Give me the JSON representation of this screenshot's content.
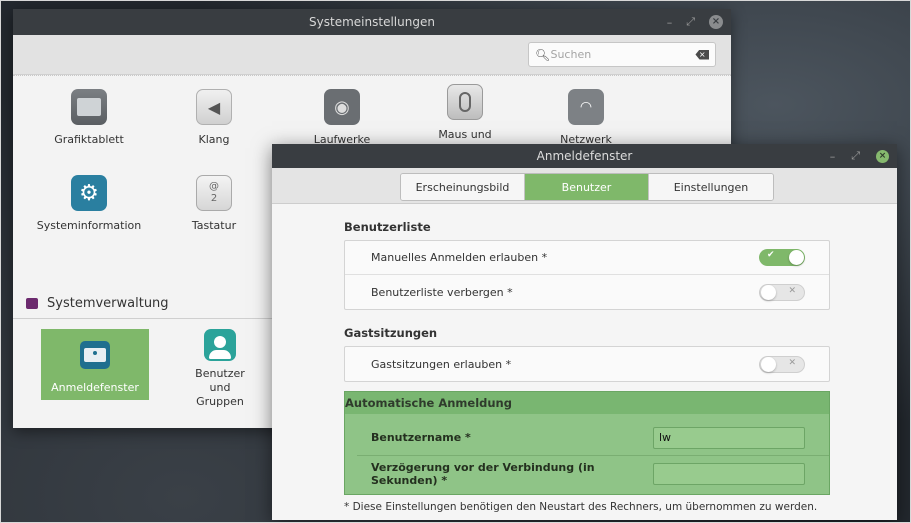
{
  "main_window": {
    "title": "Systemeinstellungen",
    "search": {
      "placeholder": "Suchen",
      "value": ""
    },
    "grid_row1": [
      {
        "label": "Grafiktablett",
        "icon": "tablet-icon"
      },
      {
        "label": "Klang",
        "icon": "speaker-icon"
      },
      {
        "label": "Laufwerke",
        "icon": "disk-icon"
      },
      {
        "label": "Maus und",
        "icon": "mouse-icon"
      },
      {
        "label": "Netzwerk",
        "icon": "wifi-icon"
      }
    ],
    "grid_row2": [
      {
        "label": "Systeminformation",
        "icon": "gear-icon"
      },
      {
        "label": "Tastatur",
        "icon": "keyboard-key-icon",
        "glyph_top": "@",
        "glyph_bottom": "2"
      }
    ],
    "section_admin": "Systemverwaltung",
    "admin_items": [
      {
        "label": "Anmeldefenster",
        "selected": true
      },
      {
        "label": "Benutzer und Gruppen",
        "selected": false
      }
    ]
  },
  "dialog": {
    "title": "Anmeldefenster",
    "tabs": [
      {
        "label": "Erscheinungsbild",
        "active": false
      },
      {
        "label": "Benutzer",
        "active": true
      },
      {
        "label": "Einstellungen",
        "active": false
      }
    ],
    "benutzerliste": {
      "heading": "Benutzerliste",
      "rows": [
        {
          "label": "Manuelles Anmelden erlauben *",
          "on": true
        },
        {
          "label": "Benutzerliste verbergen *",
          "on": false
        }
      ]
    },
    "gastsitzungen": {
      "heading": "Gastsitzungen",
      "rows": [
        {
          "label": "Gastsitzungen erlauben *",
          "on": false
        }
      ]
    },
    "auto_login": {
      "heading": "Automatische Anmeldung",
      "username_label": "Benutzername *",
      "username_value": "lw",
      "delay_label": "Verzögerung vor der Verbindung (in Sekunden) *",
      "delay_value": ""
    },
    "footnote": "* Diese Einstellungen benötigen den Neustart des Rechners, um übernommen zu werden."
  },
  "colors": {
    "accent_green": "#7fb86a",
    "titlebar": "#393d41",
    "admin_purple": "#6c2a6e"
  }
}
